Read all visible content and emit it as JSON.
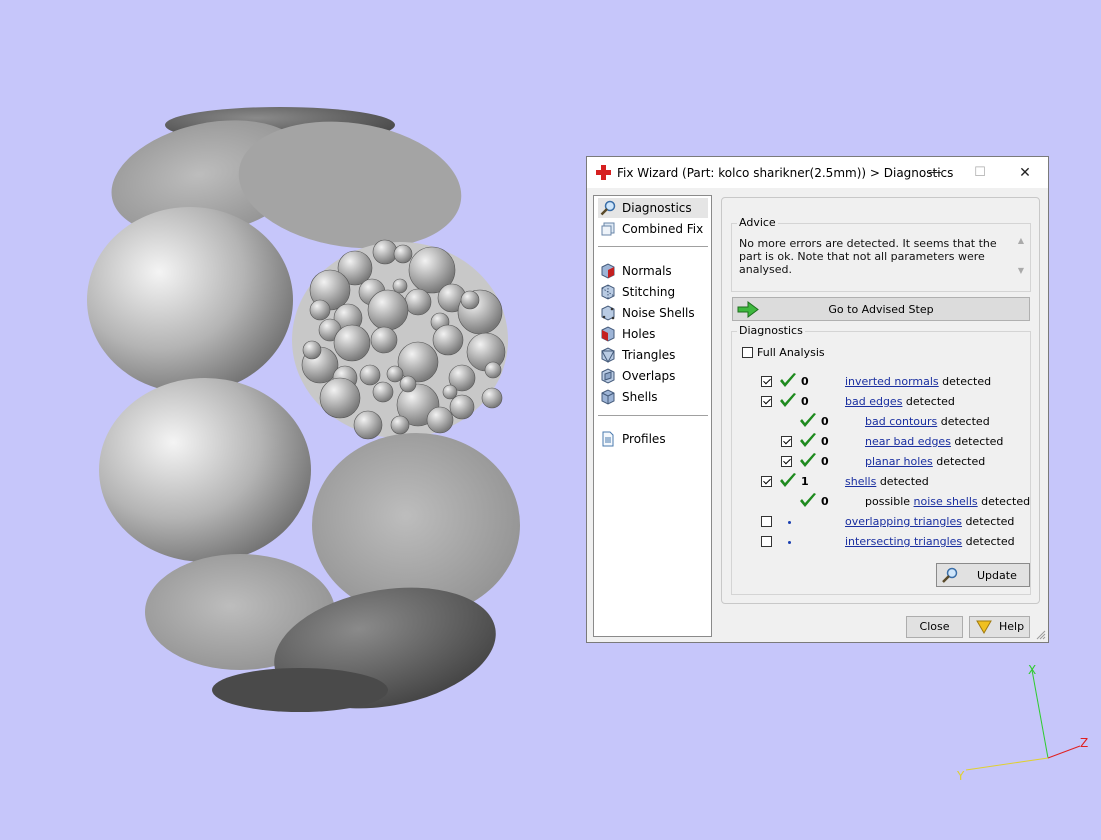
{
  "dialog": {
    "title": "Fix Wizard (Part: kolco sharikner(2.5mm)) > Diagnostics",
    "window_buttons": {
      "minimize": "—",
      "maximize": "☐",
      "close": "✕"
    }
  },
  "nav": {
    "items": [
      {
        "label": "Diagnostics",
        "icon": "magnifier-icon"
      },
      {
        "label": "Combined Fix",
        "icon": "combined-fix-icon"
      },
      {
        "label": "Normals",
        "icon": "normals-icon"
      },
      {
        "label": "Stitching",
        "icon": "stitching-icon"
      },
      {
        "label": "Noise Shells",
        "icon": "noise-shells-icon"
      },
      {
        "label": "Holes",
        "icon": "holes-icon"
      },
      {
        "label": "Triangles",
        "icon": "triangles-icon"
      },
      {
        "label": "Overlaps",
        "icon": "overlaps-icon"
      },
      {
        "label": "Shells",
        "icon": "shells-icon"
      },
      {
        "label": "Profiles",
        "icon": "profiles-icon"
      }
    ],
    "selected": "Diagnostics"
  },
  "advice": {
    "title": "Advice",
    "text": "No more errors are detected. It seems that the part is ok. Note that not all parameters were analysed."
  },
  "advised_button": {
    "label": "Go to Advised Step",
    "icon": "green-arrow-icon"
  },
  "diagnostics": {
    "title": "Diagnostics",
    "full_analysis": {
      "label": "Full Analysis",
      "checked": false
    },
    "rows": [
      {
        "pre": "",
        "link": "inverted normals",
        "post": " detected",
        "count": "0",
        "checked": true,
        "status": "ok"
      },
      {
        "pre": "",
        "link": "bad edges",
        "post": " detected",
        "count": "0",
        "checked": true,
        "status": "ok"
      },
      {
        "pre": "",
        "link": "bad contours",
        "post": " detected",
        "count": "0",
        "checked": null,
        "status": "ok"
      },
      {
        "pre": "",
        "link": "near bad edges",
        "post": " detected",
        "count": "0",
        "checked": true,
        "status": "ok"
      },
      {
        "pre": "",
        "link": "planar holes",
        "post": " detected",
        "count": "0",
        "checked": true,
        "status": "ok"
      },
      {
        "pre": "",
        "link": "shells",
        "post": " detected",
        "count": "1",
        "checked": true,
        "status": "ok"
      },
      {
        "pre": "possible ",
        "link": "noise shells",
        "post": " detected",
        "count": "0",
        "checked": null,
        "status": "ok"
      },
      {
        "pre": "",
        "link": "overlapping triangles",
        "post": " detected",
        "count": "",
        "checked": false,
        "status": "pending"
      },
      {
        "pre": "",
        "link": "intersecting triangles",
        "post": " detected",
        "count": "",
        "checked": false,
        "status": "pending"
      }
    ]
  },
  "update_button": {
    "label": "Update",
    "icon": "magnifier-icon"
  },
  "footer": {
    "close_label": "Close",
    "help_label": "Help",
    "help_icon": "help-funnel-icon"
  },
  "axis": {
    "x": "X",
    "y": "Y",
    "z": "Z"
  },
  "colors": {
    "background": "#c6c6fa",
    "check_green": "#1e8a1e",
    "link_blue": "#1a2fa0",
    "axis_x": "#2ecc2e",
    "axis_y": "#e0d030",
    "axis_z": "#e02020"
  }
}
